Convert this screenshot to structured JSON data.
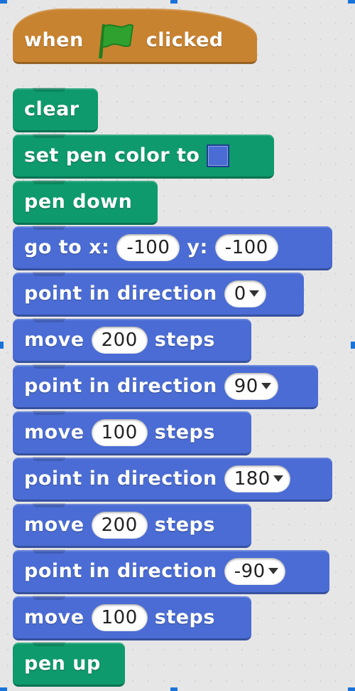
{
  "colors": {
    "motion": "#4a6cd4",
    "pen": "#0e9a6c",
    "events": "#c88330",
    "pen_color_value": "#4a6cd4",
    "flag": "#2fa12f",
    "selection_handle": "#1a73d9"
  },
  "script": {
    "hat": {
      "when": "when",
      "clicked": "clicked",
      "icon": "green-flag-icon"
    },
    "clear": "clear",
    "set_pen_color": "set pen color to",
    "pen_down": "pen down",
    "go_to": {
      "x_label": "go to x:",
      "x": "-100",
      "y_label": "y:",
      "y": "-100"
    },
    "point_1": {
      "label": "point in direction",
      "value": "0"
    },
    "move_1": {
      "label": "move",
      "value": "200",
      "suffix": "steps"
    },
    "point_2": {
      "label": "point in direction",
      "value": "90"
    },
    "move_2": {
      "label": "move",
      "value": "100",
      "suffix": "steps"
    },
    "point_3": {
      "label": "point in direction",
      "value": "180"
    },
    "move_3": {
      "label": "move",
      "value": "200",
      "suffix": "steps"
    },
    "point_4": {
      "label": "point in direction",
      "value": "-90"
    },
    "move_4": {
      "label": "move",
      "value": "100",
      "suffix": "steps"
    },
    "pen_up": "pen up"
  }
}
